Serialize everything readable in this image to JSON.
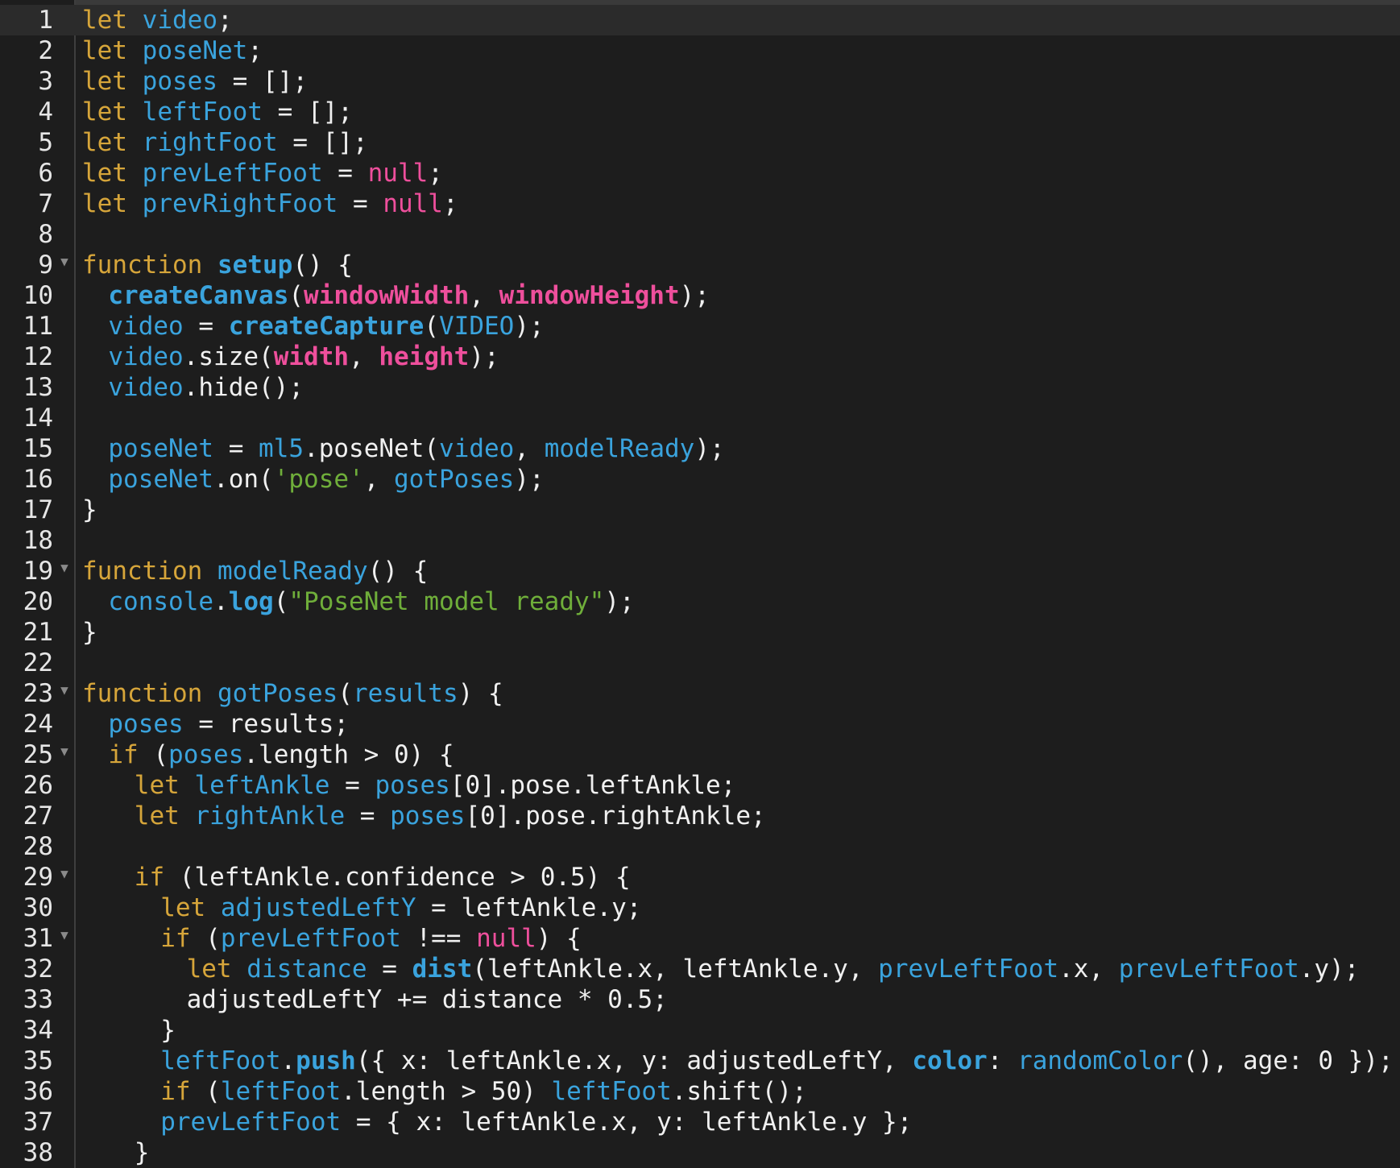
{
  "colors": {
    "background": "#1d1d1d",
    "keyword": "#d6a53a",
    "variable": "#3aa3dd",
    "builtin": "#ee4f9c",
    "string": "#6fae3a",
    "plain": "#f0f0f0"
  },
  "editor": {
    "active_line": 1,
    "lines": [
      {
        "n": "1",
        "fold": false,
        "indent": 0,
        "tokens": [
          [
            "k",
            "let"
          ],
          [
            "p",
            " "
          ],
          [
            "v",
            "video"
          ],
          [
            "p",
            ";"
          ]
        ]
      },
      {
        "n": "2",
        "fold": false,
        "indent": 0,
        "tokens": [
          [
            "k",
            "let"
          ],
          [
            "p",
            " "
          ],
          [
            "v",
            "poseNet"
          ],
          [
            "p",
            ";"
          ]
        ]
      },
      {
        "n": "3",
        "fold": false,
        "indent": 0,
        "tokens": [
          [
            "k",
            "let"
          ],
          [
            "p",
            " "
          ],
          [
            "v",
            "poses"
          ],
          [
            "p",
            " = [];"
          ]
        ]
      },
      {
        "n": "4",
        "fold": false,
        "indent": 0,
        "tokens": [
          [
            "k",
            "let"
          ],
          [
            "p",
            " "
          ],
          [
            "v",
            "leftFoot"
          ],
          [
            "p",
            " = [];"
          ]
        ]
      },
      {
        "n": "5",
        "fold": false,
        "indent": 0,
        "tokens": [
          [
            "k",
            "let"
          ],
          [
            "p",
            " "
          ],
          [
            "v",
            "rightFoot"
          ],
          [
            "p",
            " = [];"
          ]
        ]
      },
      {
        "n": "6",
        "fold": false,
        "indent": 0,
        "tokens": [
          [
            "k",
            "let"
          ],
          [
            "p",
            " "
          ],
          [
            "v",
            "prevLeftFoot"
          ],
          [
            "p",
            " = "
          ],
          [
            "n",
            "null"
          ],
          [
            "p",
            ";"
          ]
        ]
      },
      {
        "n": "7",
        "fold": false,
        "indent": 0,
        "tokens": [
          [
            "k",
            "let"
          ],
          [
            "p",
            " "
          ],
          [
            "v",
            "prevRightFoot"
          ],
          [
            "p",
            " = "
          ],
          [
            "n",
            "null"
          ],
          [
            "p",
            ";"
          ]
        ]
      },
      {
        "n": "8",
        "fold": false,
        "indent": 0,
        "tokens": []
      },
      {
        "n": "9",
        "fold": true,
        "indent": 0,
        "tokens": [
          [
            "k",
            "function"
          ],
          [
            "p",
            " "
          ],
          [
            "f",
            "setup"
          ],
          [
            "p",
            "() {"
          ]
        ]
      },
      {
        "n": "10",
        "fold": false,
        "indent": 2,
        "tokens": [
          [
            "f",
            "createCanvas"
          ],
          [
            "p",
            "("
          ],
          [
            "b",
            "windowWidth"
          ],
          [
            "p",
            ", "
          ],
          [
            "b",
            "windowHeight"
          ],
          [
            "p",
            ");"
          ]
        ]
      },
      {
        "n": "11",
        "fold": false,
        "indent": 2,
        "tokens": [
          [
            "v",
            "video"
          ],
          [
            "p",
            " = "
          ],
          [
            "f",
            "createCapture"
          ],
          [
            "p",
            "("
          ],
          [
            "v",
            "VIDEO"
          ],
          [
            "p",
            ");"
          ]
        ]
      },
      {
        "n": "12",
        "fold": false,
        "indent": 2,
        "tokens": [
          [
            "v",
            "video"
          ],
          [
            "p",
            ".size("
          ],
          [
            "b",
            "width"
          ],
          [
            "p",
            ", "
          ],
          [
            "b",
            "height"
          ],
          [
            "p",
            ");"
          ]
        ]
      },
      {
        "n": "13",
        "fold": false,
        "indent": 2,
        "tokens": [
          [
            "v",
            "video"
          ],
          [
            "p",
            ".hide();"
          ]
        ]
      },
      {
        "n": "14",
        "fold": false,
        "indent": 0,
        "tokens": []
      },
      {
        "n": "15",
        "fold": false,
        "indent": 2,
        "tokens": [
          [
            "v",
            "poseNet"
          ],
          [
            "p",
            " = "
          ],
          [
            "v",
            "ml5"
          ],
          [
            "p",
            ".poseNet("
          ],
          [
            "v",
            "video"
          ],
          [
            "p",
            ", "
          ],
          [
            "v",
            "modelReady"
          ],
          [
            "p",
            ");"
          ]
        ]
      },
      {
        "n": "16",
        "fold": false,
        "indent": 2,
        "tokens": [
          [
            "v",
            "poseNet"
          ],
          [
            "p",
            ".on("
          ],
          [
            "s",
            "'pose'"
          ],
          [
            "p",
            ", "
          ],
          [
            "v",
            "gotPoses"
          ],
          [
            "p",
            ");"
          ]
        ]
      },
      {
        "n": "17",
        "fold": false,
        "indent": 0,
        "tokens": [
          [
            "p",
            "}"
          ]
        ]
      },
      {
        "n": "18",
        "fold": false,
        "indent": 0,
        "tokens": []
      },
      {
        "n": "19",
        "fold": true,
        "indent": 0,
        "tokens": [
          [
            "k",
            "function"
          ],
          [
            "p",
            " "
          ],
          [
            "v",
            "modelReady"
          ],
          [
            "p",
            "() {"
          ]
        ]
      },
      {
        "n": "20",
        "fold": false,
        "indent": 2,
        "tokens": [
          [
            "v",
            "console"
          ],
          [
            "p",
            "."
          ],
          [
            "f",
            "log"
          ],
          [
            "p",
            "("
          ],
          [
            "s",
            "\"PoseNet model ready\""
          ],
          [
            "p",
            ");"
          ]
        ]
      },
      {
        "n": "21",
        "fold": false,
        "indent": 0,
        "tokens": [
          [
            "p",
            "}"
          ]
        ]
      },
      {
        "n": "22",
        "fold": false,
        "indent": 0,
        "tokens": []
      },
      {
        "n": "23",
        "fold": true,
        "indent": 0,
        "tokens": [
          [
            "k",
            "function"
          ],
          [
            "p",
            " "
          ],
          [
            "v",
            "gotPoses"
          ],
          [
            "p",
            "("
          ],
          [
            "v",
            "results"
          ],
          [
            "p",
            ") {"
          ]
        ]
      },
      {
        "n": "24",
        "fold": false,
        "indent": 2,
        "tokens": [
          [
            "v",
            "poses"
          ],
          [
            "p",
            " = results;"
          ]
        ]
      },
      {
        "n": "25",
        "fold": true,
        "indent": 2,
        "tokens": [
          [
            "k",
            "if"
          ],
          [
            "p",
            " ("
          ],
          [
            "v",
            "poses"
          ],
          [
            "p",
            ".length > 0) {"
          ]
        ]
      },
      {
        "n": "26",
        "fold": false,
        "indent": 4,
        "tokens": [
          [
            "k",
            "let"
          ],
          [
            "p",
            " "
          ],
          [
            "v",
            "leftAnkle"
          ],
          [
            "p",
            " = "
          ],
          [
            "v",
            "poses"
          ],
          [
            "p",
            "[0].pose.leftAnkle;"
          ]
        ]
      },
      {
        "n": "27",
        "fold": false,
        "indent": 4,
        "tokens": [
          [
            "k",
            "let"
          ],
          [
            "p",
            " "
          ],
          [
            "v",
            "rightAnkle"
          ],
          [
            "p",
            " = "
          ],
          [
            "v",
            "poses"
          ],
          [
            "p",
            "[0].pose.rightAnkle;"
          ]
        ]
      },
      {
        "n": "28",
        "fold": false,
        "indent": 0,
        "tokens": []
      },
      {
        "n": "29",
        "fold": true,
        "indent": 4,
        "tokens": [
          [
            "k",
            "if"
          ],
          [
            "p",
            " (leftAnkle.confidence > 0.5) {"
          ]
        ]
      },
      {
        "n": "30",
        "fold": false,
        "indent": 6,
        "tokens": [
          [
            "k",
            "let"
          ],
          [
            "p",
            " "
          ],
          [
            "v",
            "adjustedLeftY"
          ],
          [
            "p",
            " = leftAnkle.y;"
          ]
        ]
      },
      {
        "n": "31",
        "fold": true,
        "indent": 6,
        "tokens": [
          [
            "k",
            "if"
          ],
          [
            "p",
            " ("
          ],
          [
            "v",
            "prevLeftFoot"
          ],
          [
            "p",
            " !== "
          ],
          [
            "n",
            "null"
          ],
          [
            "p",
            ") {"
          ]
        ]
      },
      {
        "n": "32",
        "fold": false,
        "indent": 8,
        "tokens": [
          [
            "k",
            "let"
          ],
          [
            "p",
            " "
          ],
          [
            "v",
            "distance"
          ],
          [
            "p",
            " = "
          ],
          [
            "f",
            "dist"
          ],
          [
            "p",
            "(leftAnkle.x, leftAnkle.y, "
          ],
          [
            "v",
            "prevLeftFoot"
          ],
          [
            "p",
            ".x, "
          ],
          [
            "v",
            "prevLeftFoot"
          ],
          [
            "p",
            ".y);"
          ]
        ]
      },
      {
        "n": "33",
        "fold": false,
        "indent": 8,
        "tokens": [
          [
            "p",
            "adjustedLeftY += distance * 0.5;"
          ]
        ]
      },
      {
        "n": "34",
        "fold": false,
        "indent": 6,
        "tokens": [
          [
            "p",
            "}"
          ]
        ]
      },
      {
        "n": "35",
        "fold": false,
        "indent": 6,
        "tokens": [
          [
            "v",
            "leftFoot"
          ],
          [
            "p",
            "."
          ],
          [
            "f",
            "push"
          ],
          [
            "p",
            "({ x: leftAnkle.x, y: adjustedLeftY, "
          ],
          [
            "f",
            "color"
          ],
          [
            "p",
            ": "
          ],
          [
            "v",
            "randomColor"
          ],
          [
            "p",
            "(), age: 0 });"
          ]
        ]
      },
      {
        "n": "36",
        "fold": false,
        "indent": 6,
        "tokens": [
          [
            "k",
            "if"
          ],
          [
            "p",
            " ("
          ],
          [
            "v",
            "leftFoot"
          ],
          [
            "p",
            ".length > 50) "
          ],
          [
            "v",
            "leftFoot"
          ],
          [
            "p",
            ".shift();"
          ]
        ]
      },
      {
        "n": "37",
        "fold": false,
        "indent": 6,
        "tokens": [
          [
            "v",
            "prevLeftFoot"
          ],
          [
            "p",
            " = { x: leftAnkle.x, y: leftAnkle.y };"
          ]
        ]
      },
      {
        "n": "38",
        "fold": false,
        "indent": 4,
        "tokens": [
          [
            "p",
            "}"
          ]
        ]
      }
    ]
  }
}
